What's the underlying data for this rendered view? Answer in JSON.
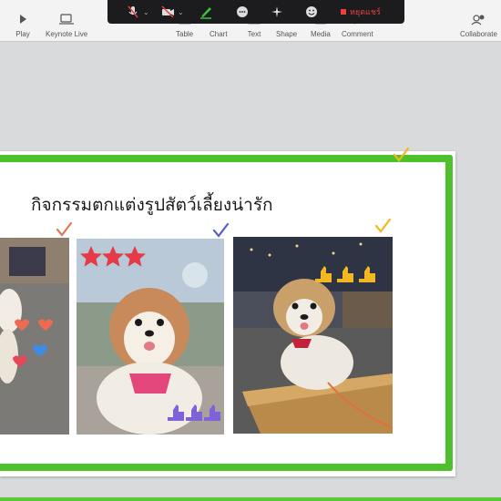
{
  "toolbar": {
    "play_label": "Play",
    "keynote_live_label": "Keynote Live",
    "table_label": "Table",
    "chart_label": "Chart",
    "text_label": "Text",
    "shape_label": "Shape",
    "media_label": "Media",
    "comment_label": "Comment",
    "collaborate_label": "Collaborate"
  },
  "zoom_bar": {
    "stop_label": "หยุดแชร์",
    "stop_color": "#e8413f"
  },
  "slide": {
    "title": "กิจกรรมตกแต่งรูปสัตว์เลี้ยงน่ารัก",
    "frame_color": "#4cc12b"
  },
  "icons": [
    "play-icon",
    "keynote-live-icon",
    "table-icon",
    "chart-icon",
    "text-icon",
    "shape-icon",
    "media-icon",
    "comment-icon",
    "collaborate-icon",
    "mic-muted-icon",
    "video-off-icon",
    "annotate-pen-icon",
    "chat-icon",
    "sparkle-icon",
    "emoji-icon",
    "checkmark-icon"
  ]
}
